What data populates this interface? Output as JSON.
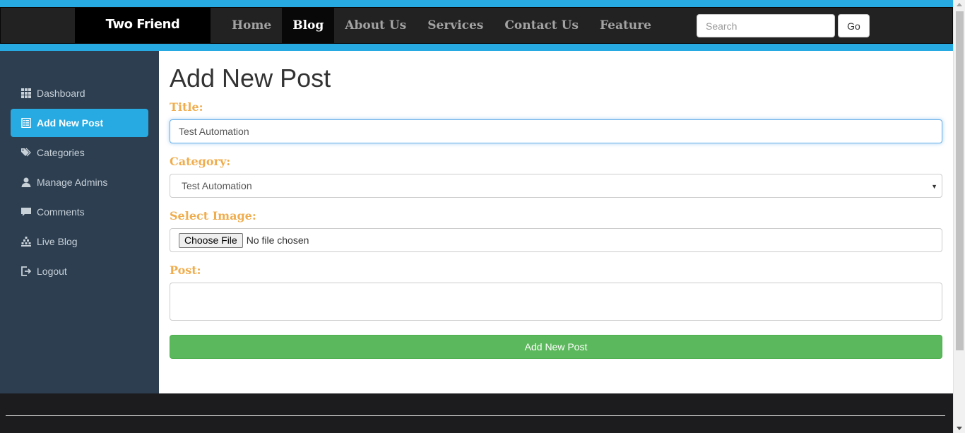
{
  "header": {
    "brand": "Two Friend",
    "nav": [
      {
        "label": "Home"
      },
      {
        "label": "Blog",
        "active": true
      },
      {
        "label": "About Us"
      },
      {
        "label": "Services"
      },
      {
        "label": "Contact Us"
      },
      {
        "label": "Feature"
      }
    ],
    "search_placeholder": "Search",
    "search_button": "Go"
  },
  "sidebar": {
    "items": [
      {
        "label": "Dashboard",
        "icon": "grid-icon"
      },
      {
        "label": "Add New Post",
        "icon": "list-icon",
        "active": true
      },
      {
        "label": "Categories",
        "icon": "tags-icon"
      },
      {
        "label": "Manage Admins",
        "icon": "user-icon"
      },
      {
        "label": "Comments",
        "icon": "comment-icon"
      },
      {
        "label": "Live Blog",
        "icon": "tree-icon"
      },
      {
        "label": "Logout",
        "icon": "logout-icon"
      }
    ]
  },
  "main": {
    "title": "Add New Post",
    "title_label": "Title:",
    "title_value": "Test Automation",
    "category_label": "Category:",
    "category_value": "Test Automation",
    "image_label": "Select Image:",
    "file_button": "Choose File",
    "file_status": "No file chosen",
    "post_label": "Post:",
    "post_value": "",
    "submit_label": "Add New Post"
  },
  "colors": {
    "accent": "#27aae1",
    "navbar": "#222222",
    "sidebar": "#2c3e50",
    "label": "#f0ad4e",
    "submit": "#5cb85c"
  }
}
